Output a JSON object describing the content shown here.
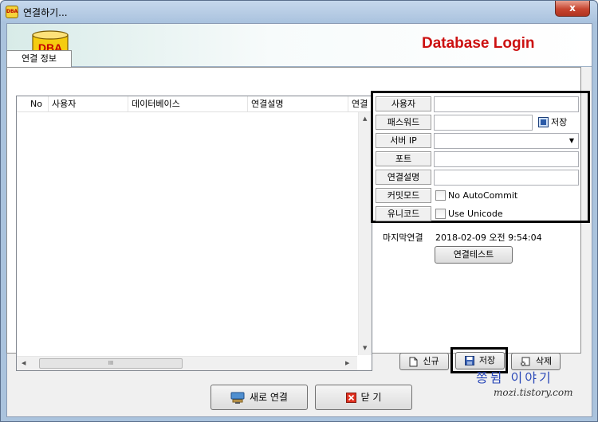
{
  "window": {
    "title": "연결하기...",
    "close_glyph": "x",
    "app_icon_text": "DBA"
  },
  "banner": {
    "logo_text": "DBA",
    "title": "Database Login"
  },
  "tab": {
    "label": "연결 정보"
  },
  "list": {
    "columns": [
      "No",
      "사용자",
      "데이터베이스",
      "연결설명",
      "연결"
    ],
    "rows": [],
    "scroll_grip": "III"
  },
  "form": {
    "user": {
      "label": "사용자",
      "value": ""
    },
    "password": {
      "label": "패스워드",
      "value": "",
      "save_label": "저장",
      "save_checked": true
    },
    "server_ip": {
      "label": "서버 IP",
      "value": ""
    },
    "port": {
      "label": "포트",
      "value": ""
    },
    "description": {
      "label": "연결설명",
      "value": ""
    },
    "commit_mode": {
      "label": "커밋모드",
      "option": "No AutoCommit",
      "checked": false
    },
    "unicode": {
      "label": "유니코드",
      "option": "Use Unicode",
      "checked": false
    }
  },
  "last_connection": {
    "label": "마지막연결",
    "value": "2018-02-09 오전 9:54:04"
  },
  "buttons": {
    "test": "연결테스트",
    "new": "신규",
    "save": "저장",
    "delete": "삭제",
    "new_connection": "새로 연결",
    "close": "닫  기"
  },
  "watermark": {
    "line1": "쫑뒴 이야기",
    "line2": "mozi.tistory.com"
  },
  "colors": {
    "banner_title": "#cc1111",
    "accent_blue": "#2a48b8"
  }
}
